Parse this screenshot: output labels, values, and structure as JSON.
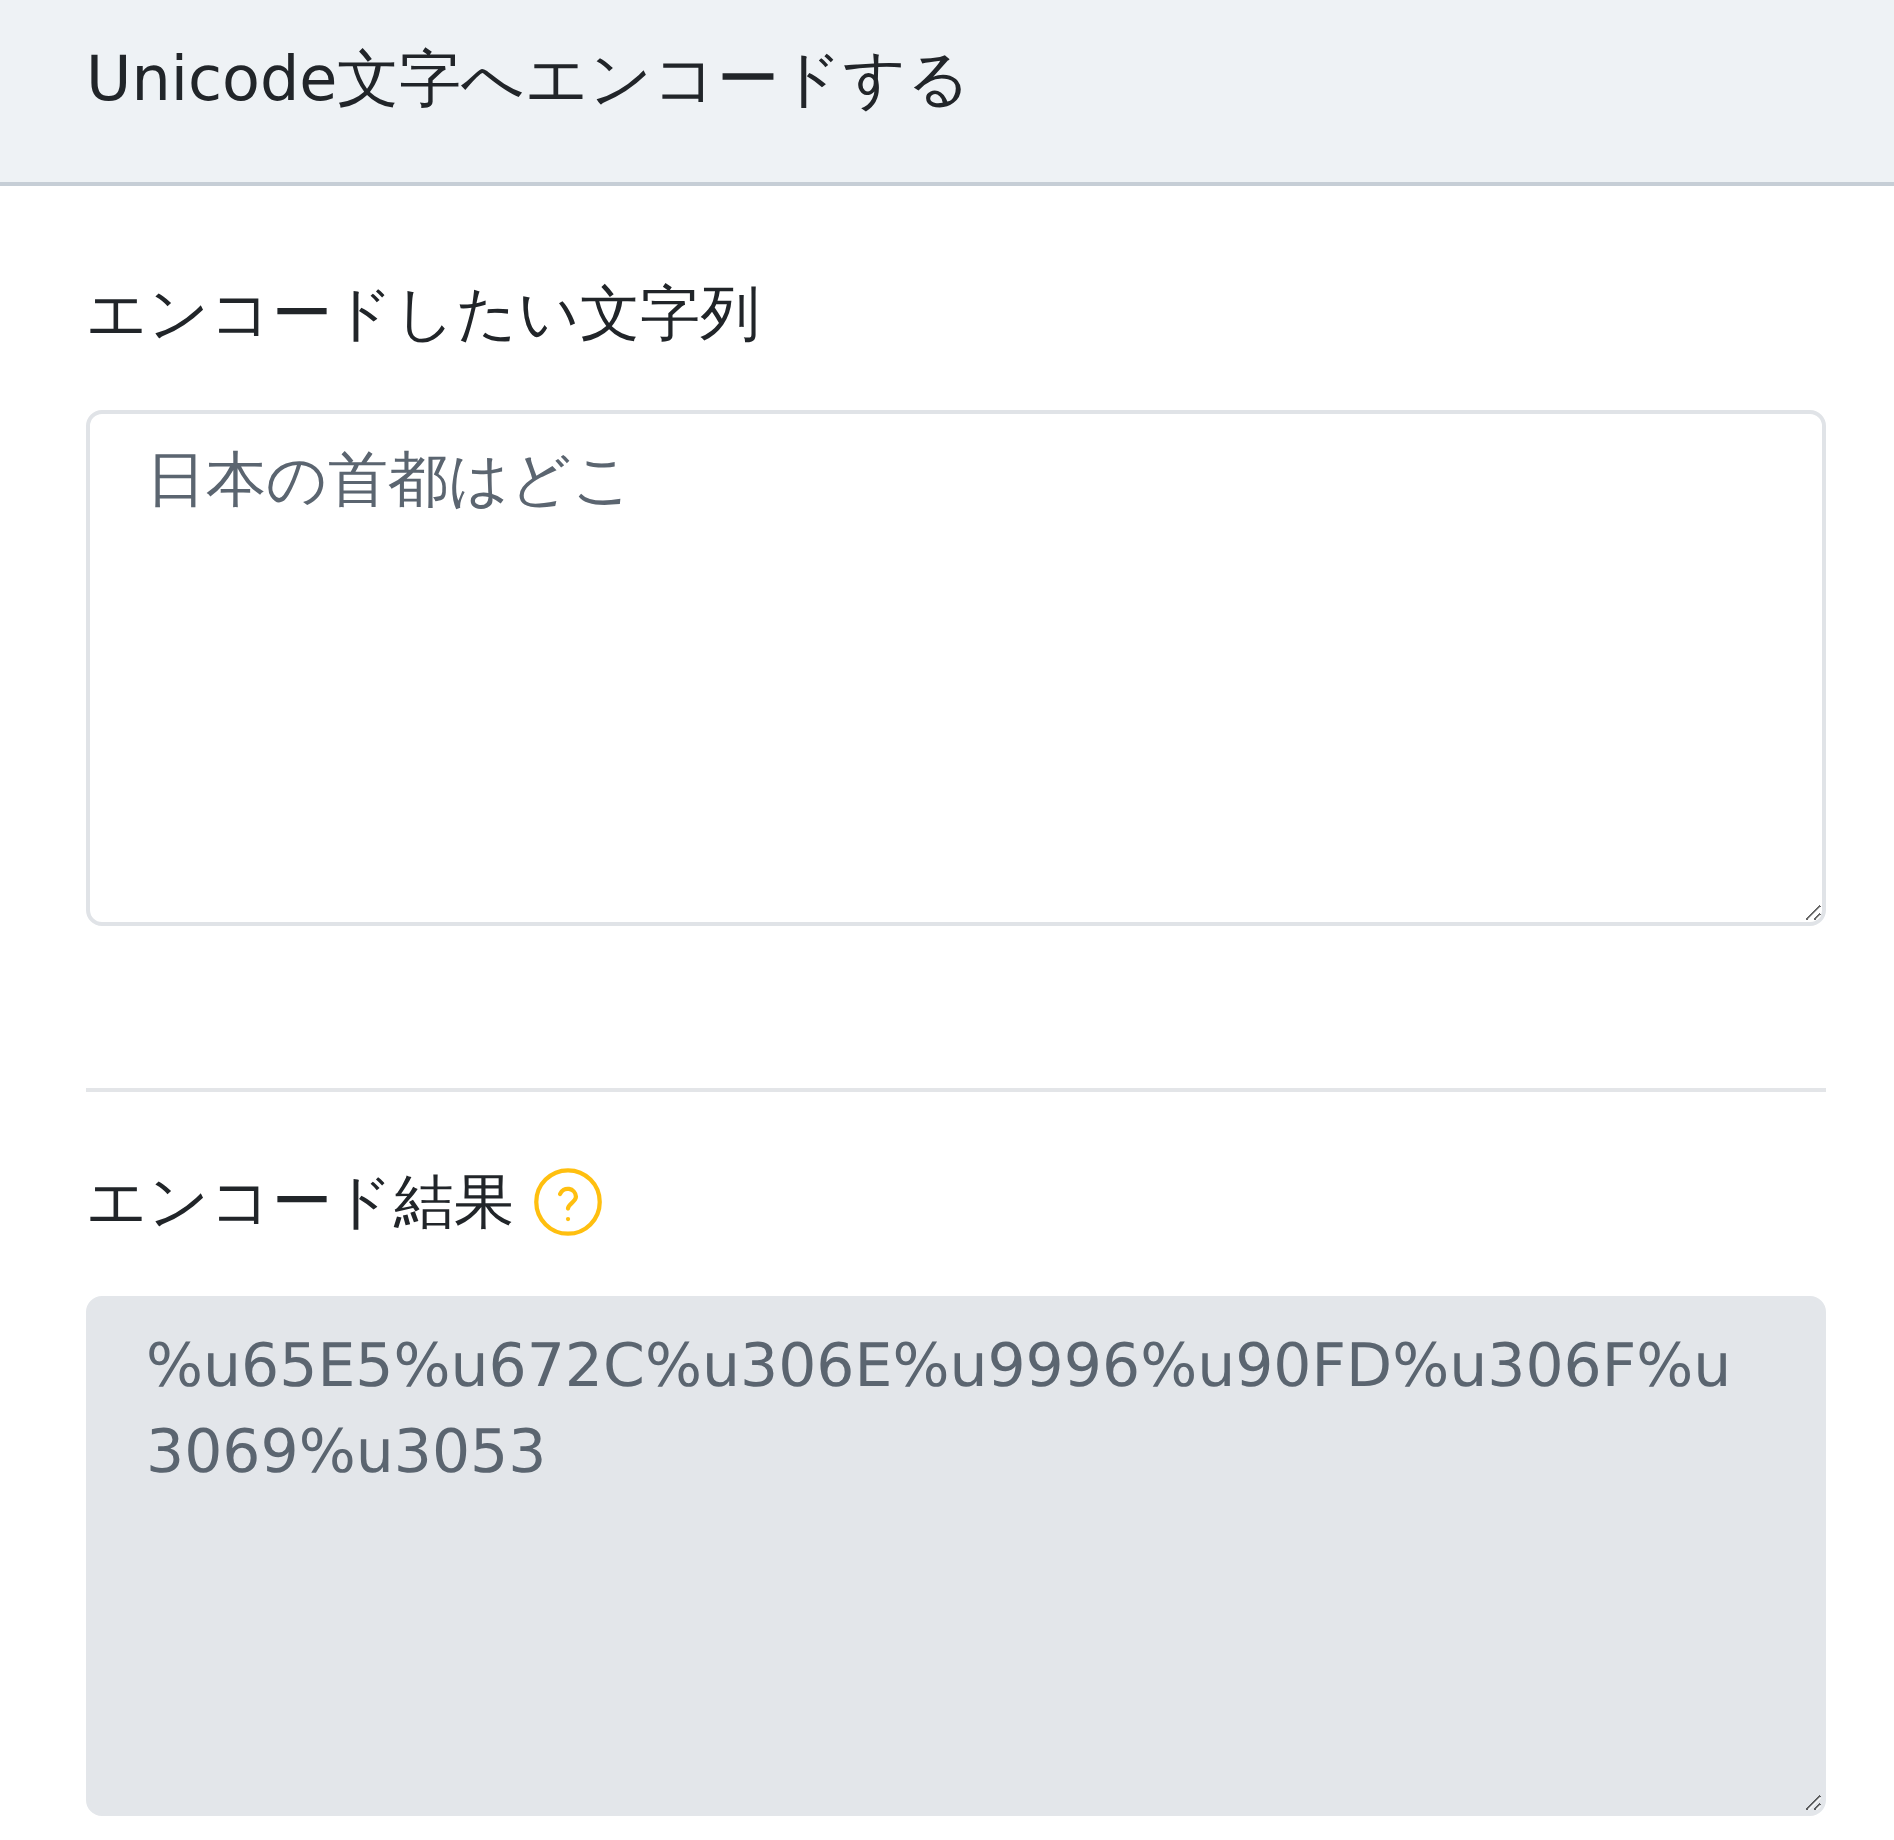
{
  "header": {
    "title": "Unicode文字へエンコードする"
  },
  "sections": [
    {
      "label": "エンコードしたい文字列",
      "help": false,
      "field": {
        "value": "日本の首都はどこ",
        "readonly": false
      }
    },
    {
      "label": "エンコード結果",
      "help": true,
      "field": {
        "value": "%u65E5%u672C%u306E%u9996%u90FD%u306F%u3069%u3053",
        "readonly": true
      }
    }
  ]
}
